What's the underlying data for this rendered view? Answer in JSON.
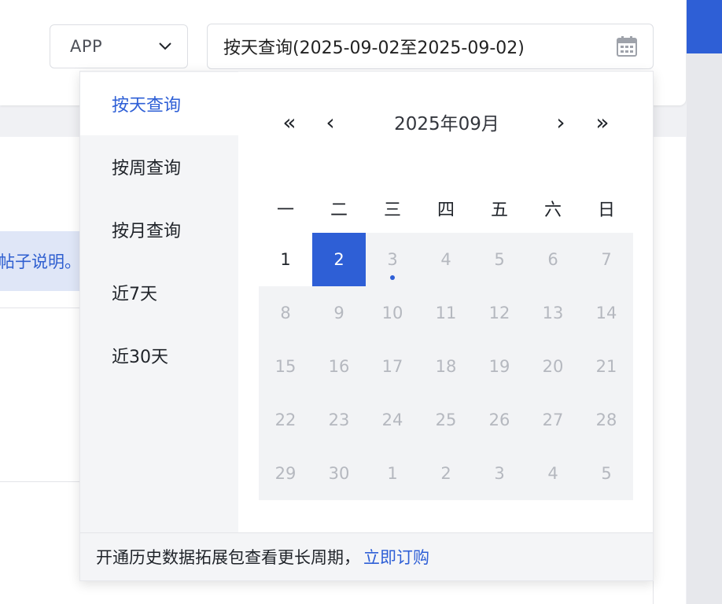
{
  "filters": {
    "platform": {
      "value": "APP"
    },
    "date_range": {
      "value": "按天查询(2025-09-02至2025-09-02)"
    }
  },
  "background": {
    "notice_text": "帖子说明。"
  },
  "picker": {
    "quick_options": [
      {
        "label": "按天查询",
        "active": true
      },
      {
        "label": "按周查询",
        "active": false
      },
      {
        "label": "按月查询",
        "active": false
      },
      {
        "label": "近7天",
        "active": false
      },
      {
        "label": "近30天",
        "active": false
      }
    ],
    "nav": {
      "prev_year": "«",
      "prev_month": "‹",
      "next_month": "›",
      "next_year": "»"
    },
    "month_title": "2025年09月",
    "weekdays": [
      "一",
      "二",
      "三",
      "四",
      "五",
      "六",
      "日"
    ],
    "days": [
      {
        "label": "1",
        "state": "enabled"
      },
      {
        "label": "2",
        "state": "selected"
      },
      {
        "label": "3",
        "state": "disabled",
        "today": true
      },
      {
        "label": "4",
        "state": "disabled"
      },
      {
        "label": "5",
        "state": "disabled"
      },
      {
        "label": "6",
        "state": "disabled"
      },
      {
        "label": "7",
        "state": "disabled"
      },
      {
        "label": "8",
        "state": "disabled"
      },
      {
        "label": "9",
        "state": "disabled"
      },
      {
        "label": "10",
        "state": "disabled"
      },
      {
        "label": "11",
        "state": "disabled"
      },
      {
        "label": "12",
        "state": "disabled"
      },
      {
        "label": "13",
        "state": "disabled"
      },
      {
        "label": "14",
        "state": "disabled"
      },
      {
        "label": "15",
        "state": "disabled"
      },
      {
        "label": "16",
        "state": "disabled"
      },
      {
        "label": "17",
        "state": "disabled"
      },
      {
        "label": "18",
        "state": "disabled"
      },
      {
        "label": "19",
        "state": "disabled"
      },
      {
        "label": "20",
        "state": "disabled"
      },
      {
        "label": "21",
        "state": "disabled"
      },
      {
        "label": "22",
        "state": "disabled"
      },
      {
        "label": "23",
        "state": "disabled"
      },
      {
        "label": "24",
        "state": "disabled"
      },
      {
        "label": "25",
        "state": "disabled"
      },
      {
        "label": "26",
        "state": "disabled"
      },
      {
        "label": "27",
        "state": "disabled"
      },
      {
        "label": "28",
        "state": "disabled"
      },
      {
        "label": "29",
        "state": "disabled"
      },
      {
        "label": "30",
        "state": "disabled"
      },
      {
        "label": "1",
        "state": "disabled"
      },
      {
        "label": "2",
        "state": "disabled"
      },
      {
        "label": "3",
        "state": "disabled"
      },
      {
        "label": "4",
        "state": "disabled"
      },
      {
        "label": "5",
        "state": "disabled"
      }
    ],
    "footer": {
      "text": "开通历史数据拓展包查看更长周期，",
      "link": "立即订购"
    }
  },
  "colors": {
    "accent": "#2e5fd6",
    "disabled_text": "#b5b8bf",
    "disabled_bg": "#f2f3f5"
  },
  "icons": {
    "platform_select": "chevron-down-icon",
    "date_input": "calendar-icon"
  }
}
